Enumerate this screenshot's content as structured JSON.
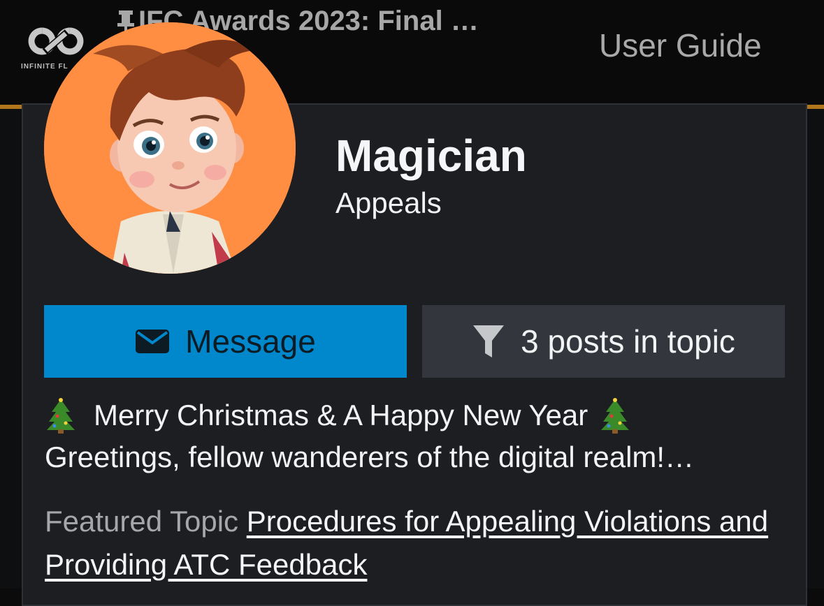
{
  "header": {
    "logo_text": "INFINITE FL",
    "topic_title": "IFC Awards 2023: Final …",
    "user_guide_label": "User Guide",
    "accent_color": "#b0761c"
  },
  "user_card": {
    "name": "Magician",
    "group": "Appeals",
    "message_button": {
      "icon": "envelope-icon",
      "label": "Message",
      "color": "#0087cc"
    },
    "posts_button": {
      "icon": "filter-icon",
      "label": "3 posts in topic"
    },
    "bio": {
      "line1": "Merry Christmas & A Happy New Year",
      "line2": "Greetings, fellow wanderers of the digital realm!…"
    },
    "featured": {
      "label": "Featured Topic",
      "link_text": "Procedures for Appealing Violations and Providing ATC Feedback"
    }
  }
}
